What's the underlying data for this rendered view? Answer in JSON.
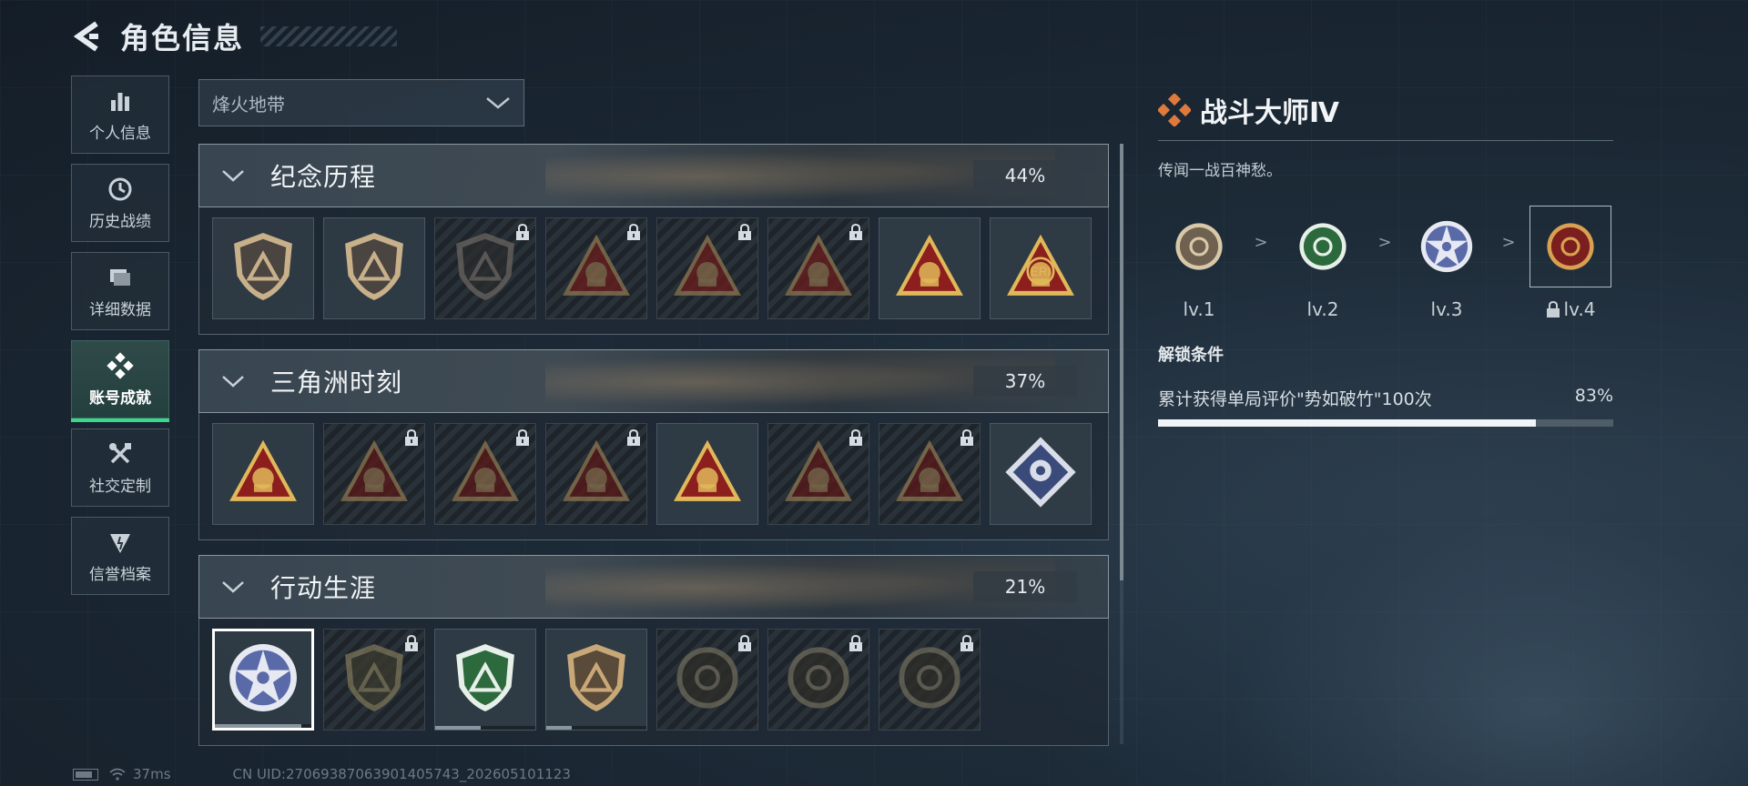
{
  "header": {
    "title": "角色信息"
  },
  "sidebar": {
    "items": [
      {
        "label": "个人信息",
        "icon": "bar-chart-icon",
        "active": false
      },
      {
        "label": "历史战绩",
        "icon": "clock-icon",
        "active": false
      },
      {
        "label": "详细数据",
        "icon": "folder-icon",
        "active": false
      },
      {
        "label": "账号成就",
        "icon": "achievement-icon",
        "active": true
      },
      {
        "label": "社交定制",
        "icon": "tools-icon",
        "active": false
      },
      {
        "label": "信誉档案",
        "icon": "reputation-icon",
        "active": false
      }
    ]
  },
  "mode_select": {
    "value": "烽火地带"
  },
  "sections": [
    {
      "title": "纪念历程",
      "percent": "44%",
      "badges": [
        {
          "shape": "shield",
          "primary": "#4a4540",
          "accent": "#c7b08a",
          "locked": false
        },
        {
          "shape": "shield",
          "primary": "#4a4540",
          "accent": "#c7b08a",
          "locked": false
        },
        {
          "shape": "shield",
          "primary": "#2b2d2e",
          "accent": "#6a6560",
          "locked": true
        },
        {
          "shape": "triangle",
          "primary": "#6a1c1c",
          "accent": "#8c7650",
          "locked": true
        },
        {
          "shape": "triangle",
          "primary": "#6a1c1c",
          "accent": "#8c7650",
          "locked": true
        },
        {
          "shape": "triangle",
          "primary": "#6a1c1c",
          "accent": "#8c7650",
          "locked": true
        },
        {
          "shape": "triangle",
          "primary": "#8c1e1e",
          "accent": "#e0b85a",
          "locked": false
        },
        {
          "shape": "triangle",
          "primary": "#8c1e1e",
          "accent": "#e0b85a",
          "locked": false,
          "label": "ERI"
        }
      ]
    },
    {
      "title": "三角洲时刻",
      "percent": "37%",
      "badges": [
        {
          "shape": "triangle",
          "primary": "#8c1e1e",
          "accent": "#e0b85a",
          "locked": false
        },
        {
          "shape": "triangle",
          "primary": "#5a1818",
          "accent": "#8c7650",
          "locked": true
        },
        {
          "shape": "triangle",
          "primary": "#5a1818",
          "accent": "#8c7650",
          "locked": true
        },
        {
          "shape": "triangle",
          "primary": "#5a1818",
          "accent": "#8c7650",
          "locked": true
        },
        {
          "shape": "triangle",
          "primary": "#8c1e1e",
          "accent": "#e0b85a",
          "locked": false
        },
        {
          "shape": "triangle",
          "primary": "#5a1818",
          "accent": "#8c7650",
          "locked": true
        },
        {
          "shape": "triangle",
          "primary": "#5a1818",
          "accent": "#8c7650",
          "locked": true
        },
        {
          "shape": "diamond",
          "primary": "#3a4a7a",
          "accent": "#d8dde8",
          "locked": false
        }
      ]
    },
    {
      "title": "行动生涯",
      "percent": "21%",
      "badges": [
        {
          "shape": "star-circle",
          "primary": "#5a6aa8",
          "accent": "#e6e9f2",
          "locked": false,
          "selected": true,
          "progress": 0.9
        },
        {
          "shape": "shield",
          "primary": "#3a3a2e",
          "accent": "#7c7558",
          "locked": true
        },
        {
          "shape": "shield",
          "primary": "#2c6a3e",
          "accent": "#e6efe8",
          "locked": false,
          "progress": 0.45
        },
        {
          "shape": "shield",
          "primary": "#5a4a3a",
          "accent": "#c9a878",
          "locked": false,
          "progress": 0.25
        },
        {
          "shape": "circle",
          "primary": "#2e2e28",
          "accent": "#6e6a5a",
          "locked": true
        },
        {
          "shape": "circle",
          "primary": "#2e2e28",
          "accent": "#6e6a5a",
          "locked": true
        },
        {
          "shape": "circle",
          "primary": "#2e2e28",
          "accent": "#6e6a5a",
          "locked": true
        }
      ]
    }
  ],
  "detail": {
    "title": "战斗大师Ⅳ",
    "description": "传闻一战百神愁。",
    "levels": [
      {
        "label": "lv.1",
        "primary": "#6e6150",
        "accent": "#d8c8a8",
        "locked": false
      },
      {
        "label": "lv.2",
        "primary": "#2c6a3e",
        "accent": "#e6efe8",
        "locked": false
      },
      {
        "label": "lv.3",
        "primary": "#5a6aa8",
        "accent": "#e6e9f2",
        "locked": false
      },
      {
        "label": "lv.4",
        "primary": "#7a1e1e",
        "accent": "#d8a050",
        "locked": true,
        "current": true
      }
    ],
    "separator": ">",
    "unlock_title": "解锁条件",
    "condition_text": "累计获得单局评价\"势如破竹\"100次",
    "condition_percent": "83%",
    "condition_progress": 0.83,
    "accent_color": "#e07a3c"
  },
  "footer": {
    "ping": "37ms",
    "uid": "CN UID:27069387063901405743_202605101123"
  }
}
